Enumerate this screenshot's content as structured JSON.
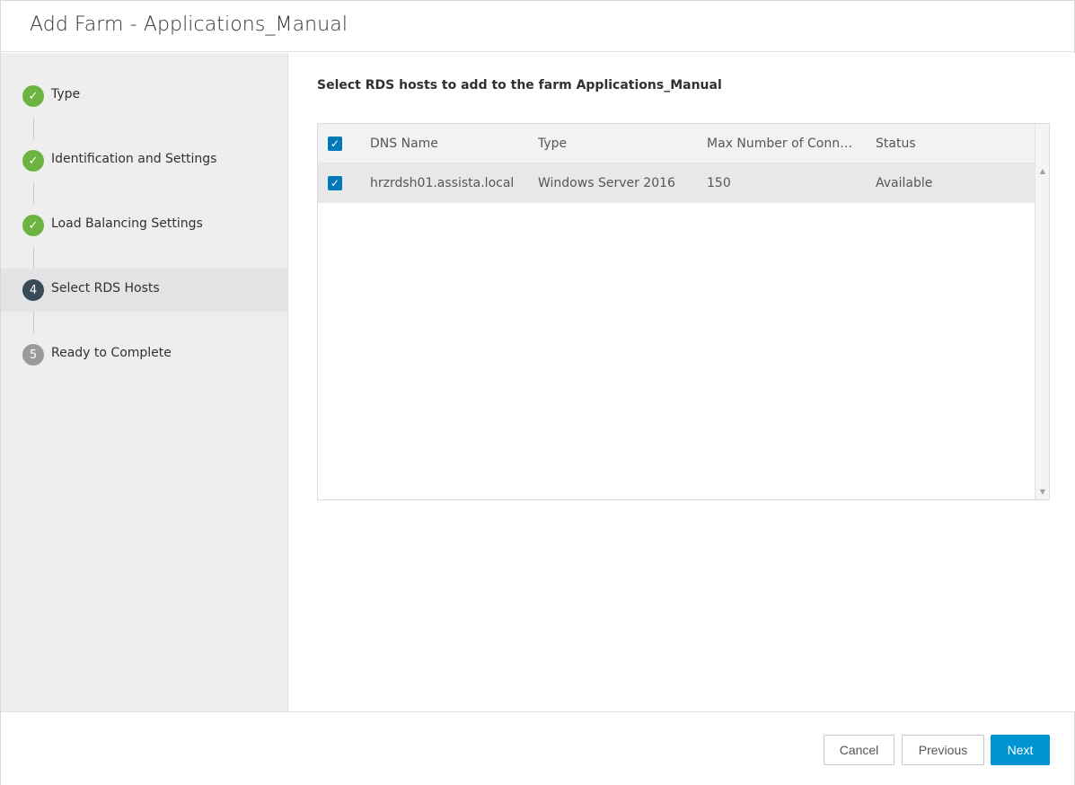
{
  "window": {
    "title": "Add Farm - Applications_Manual"
  },
  "wizard": {
    "steps": [
      {
        "marker": "✓",
        "label": "Type",
        "state": "done"
      },
      {
        "marker": "✓",
        "label": "Identification and Settings",
        "state": "done"
      },
      {
        "marker": "✓",
        "label": "Load Balancing Settings",
        "state": "done"
      },
      {
        "marker": "4",
        "label": "Select RDS Hosts",
        "state": "current"
      },
      {
        "marker": "5",
        "label": "Ready to Complete",
        "state": "pending"
      }
    ]
  },
  "main": {
    "instruction": "Select RDS hosts to add to the farm Applications_Manual",
    "grid": {
      "select_all_checked": true,
      "columns": [
        "DNS Name",
        "Type",
        "Max Number of Conne...",
        "Status"
      ],
      "rows": [
        {
          "checked": true,
          "dns_name": "hrzrdsh01.assista.local",
          "type": "Windows Server 2016",
          "max_connections": "150",
          "status": "Available"
        }
      ]
    }
  },
  "footer": {
    "cancel_label": "Cancel",
    "previous_label": "Previous",
    "next_label": "Next"
  },
  "icons": {
    "check_glyph": "✓",
    "scroll_up": "▲",
    "scroll_down": "▼"
  },
  "colors": {
    "step_done": "#6db33f",
    "step_current": "#394a59",
    "step_pending": "#9a9a9a",
    "checkbox": "#0079b8",
    "primary_button": "#0094d2"
  }
}
